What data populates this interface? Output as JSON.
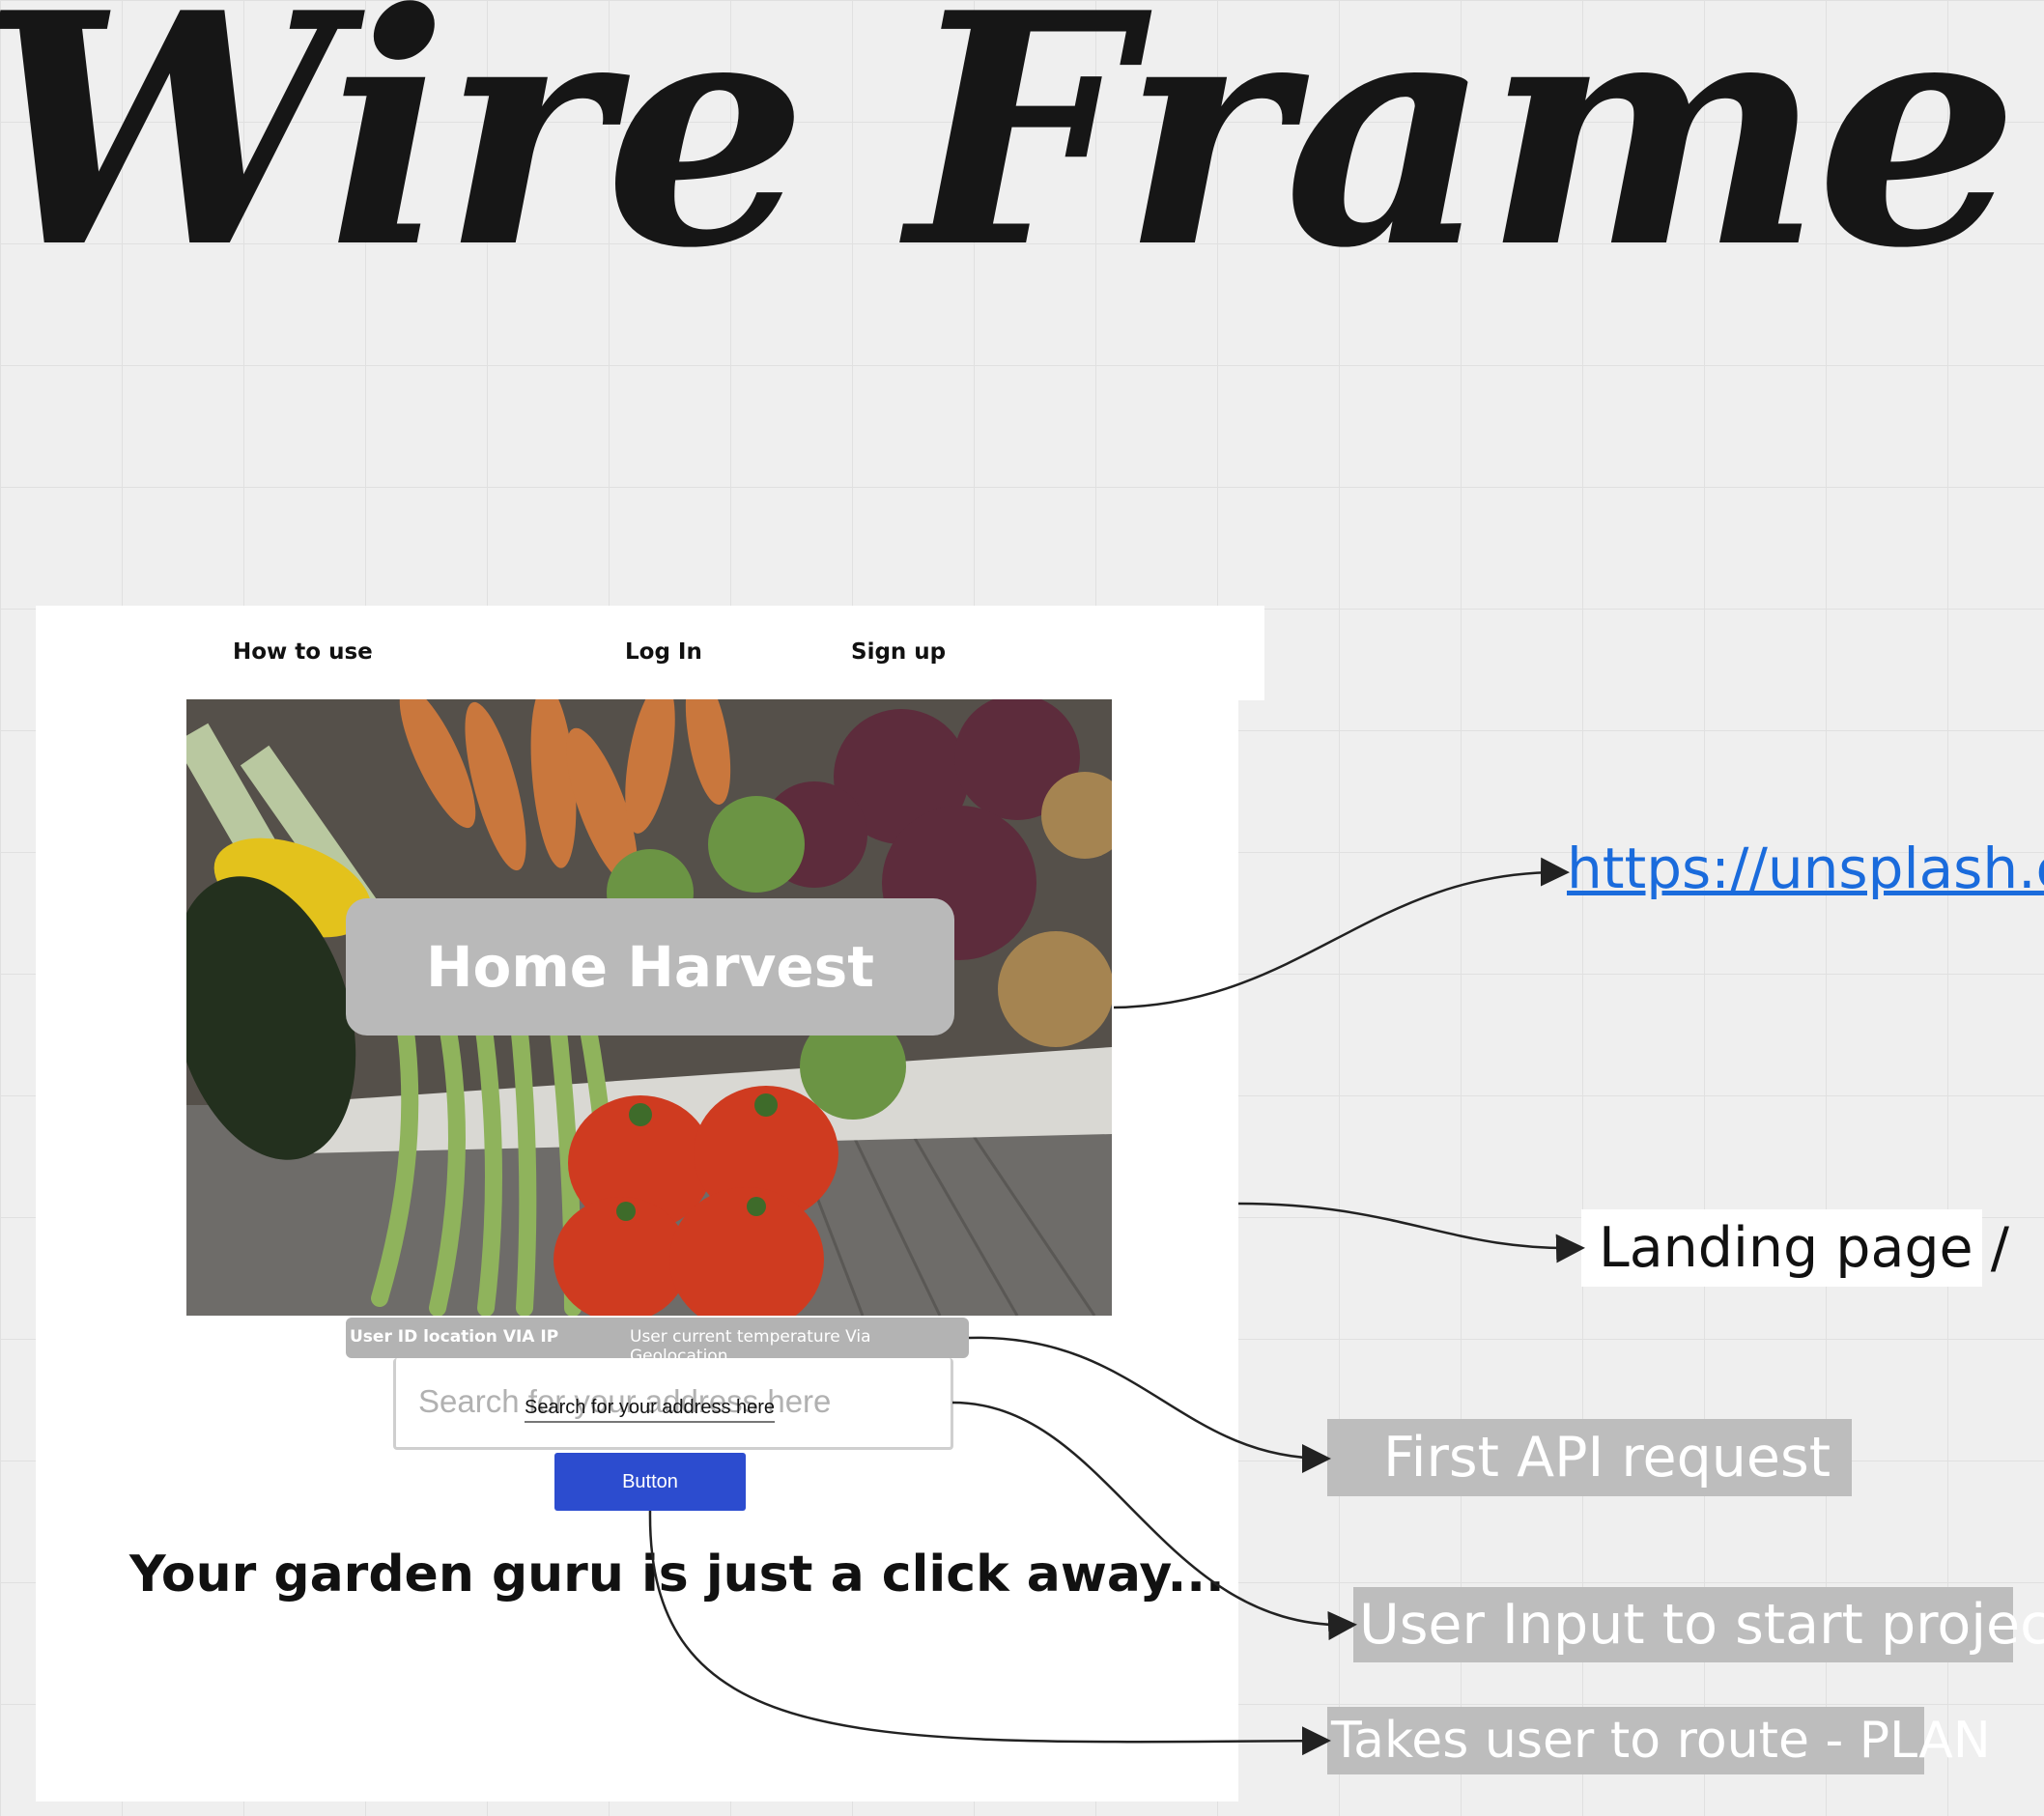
{
  "title": "Wire Frame",
  "wireframe": {
    "nav": {
      "how_to_use": "How to use",
      "log_in": "Log In",
      "sign_up": "Sign up"
    },
    "hero_title": "Home Harvest",
    "info_bar": {
      "left": "User ID location VIA IP",
      "right": "User current temperature Via Geolocation"
    },
    "search": {
      "placeholder": "Search for your address here",
      "label": "Search for your address here"
    },
    "button_label": "Button",
    "tagline": "Your garden guru is just a click away..."
  },
  "annotations": {
    "image_link": "https://unsplash.co",
    "landing_page": "Landing page /",
    "first_api_request": "First API request",
    "user_input": "User Input to start project",
    "route_plan": "Takes user to route - PLAN"
  },
  "colors": {
    "button": "#2c4ccf",
    "link": "#1a6bdc",
    "annotation_gray": "#bdbdbd"
  }
}
